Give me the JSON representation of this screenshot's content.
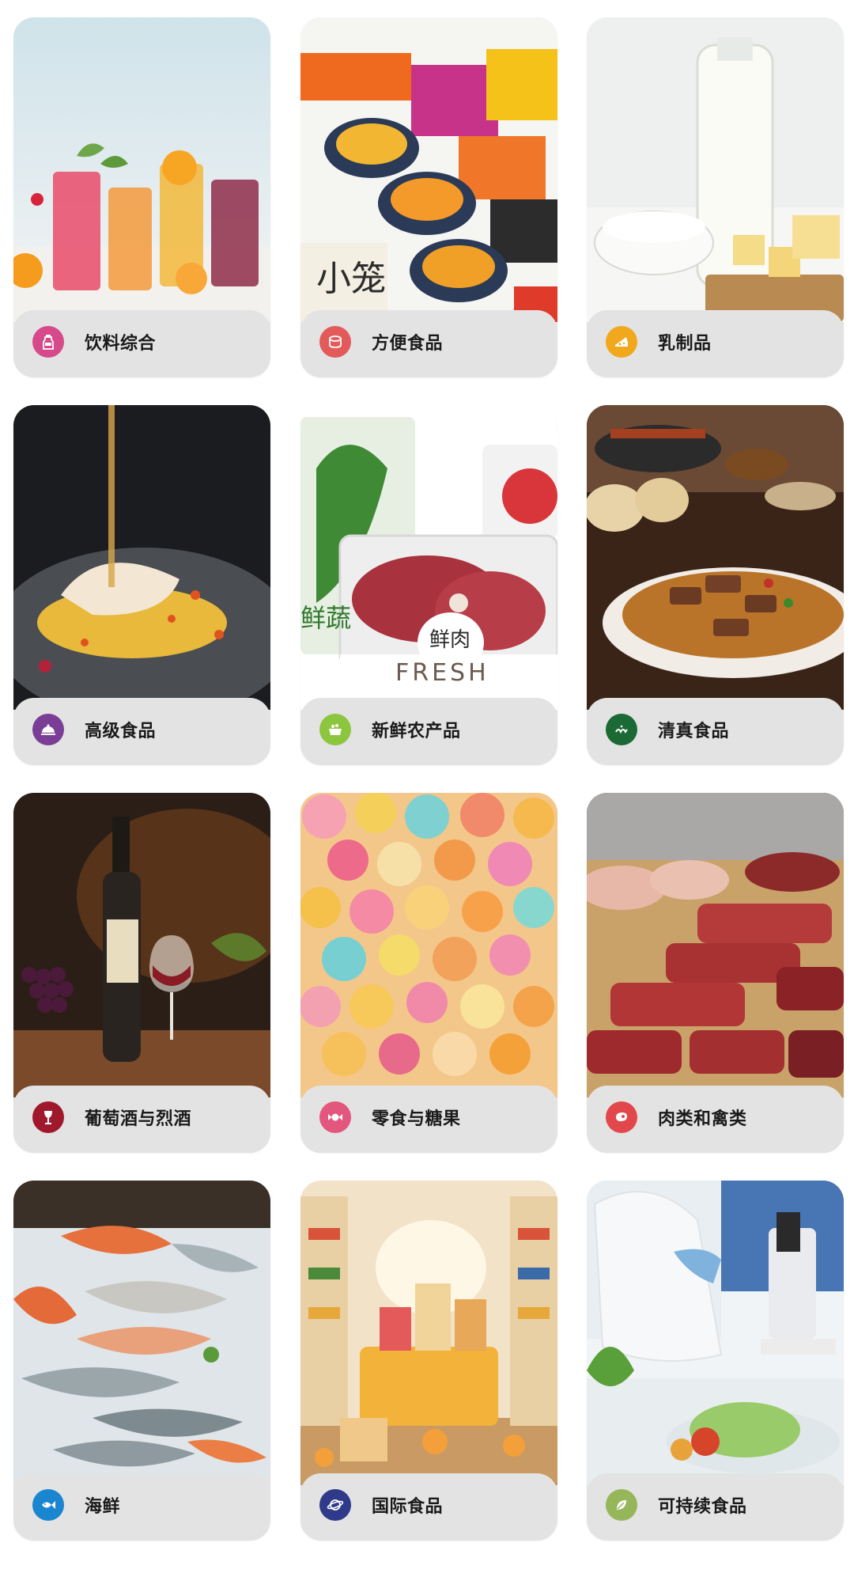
{
  "categories": [
    {
      "label": "饮料综合",
      "icon": "beverage-bottle-icon",
      "color": "#d6498a"
    },
    {
      "label": "方便食品",
      "icon": "canned-food-icon",
      "color": "#e35a5a"
    },
    {
      "label": "乳制品",
      "icon": "cheese-icon",
      "color": "#f2a81d"
    },
    {
      "label": "高级食品",
      "icon": "cloche-icon",
      "color": "#7a3e97"
    },
    {
      "label": "新鲜农产品",
      "icon": "basket-icon",
      "color": "#8cc63f"
    },
    {
      "label": "清真食品",
      "icon": "halal-icon",
      "color": "#1b6a35"
    },
    {
      "label": "葡萄酒与烈酒",
      "icon": "wine-glass-icon",
      "color": "#a0182c"
    },
    {
      "label": "零食与糖果",
      "icon": "candy-icon",
      "color": "#e3567d"
    },
    {
      "label": "肉类和禽类",
      "icon": "meat-icon",
      "color": "#e2484b"
    },
    {
      "label": "海鲜",
      "icon": "fish-icon",
      "color": "#1a86cf"
    },
    {
      "label": "国际食品",
      "icon": "globe-icon",
      "color": "#2f3a8a"
    },
    {
      "label": "可持续食品",
      "icon": "leaf-icon",
      "color": "#96b65a"
    }
  ]
}
